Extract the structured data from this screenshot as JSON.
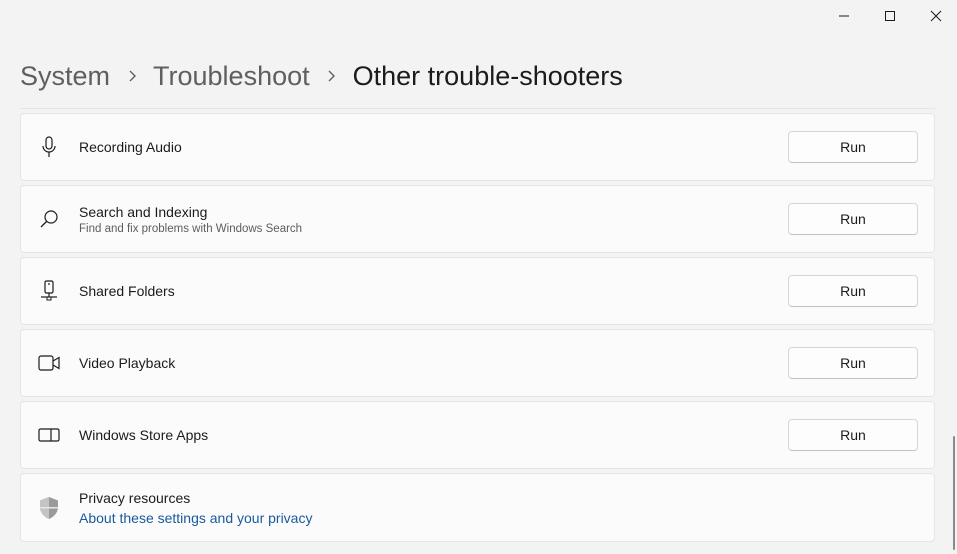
{
  "window": {
    "minimize_icon": "minimize-icon",
    "maximize_icon": "maximize-icon",
    "close_icon": "close-icon"
  },
  "breadcrumb": {
    "items": [
      "System",
      "Troubleshoot",
      "Other trouble-shooters"
    ],
    "separator_icon": "chevron-right-icon"
  },
  "troubleshooters": [
    {
      "title": "Recording Audio",
      "subtitle": "",
      "icon": "microphone-icon",
      "button": "Run"
    },
    {
      "title": "Search and Indexing",
      "subtitle": "Find and fix problems with Windows Search",
      "icon": "search-icon",
      "button": "Run"
    },
    {
      "title": "Shared Folders",
      "subtitle": "",
      "icon": "shared-folder-icon",
      "button": "Run"
    },
    {
      "title": "Video Playback",
      "subtitle": "",
      "icon": "video-camera-icon",
      "button": "Run"
    },
    {
      "title": "Windows Store Apps",
      "subtitle": "",
      "icon": "store-apps-icon",
      "button": "Run"
    }
  ],
  "privacy": {
    "title": "Privacy resources",
    "link": "About these settings and your privacy",
    "icon": "shield-icon"
  },
  "colors": {
    "background": "#f3f3f3",
    "card": "#fbfbfb",
    "link": "#1a5a9c"
  }
}
